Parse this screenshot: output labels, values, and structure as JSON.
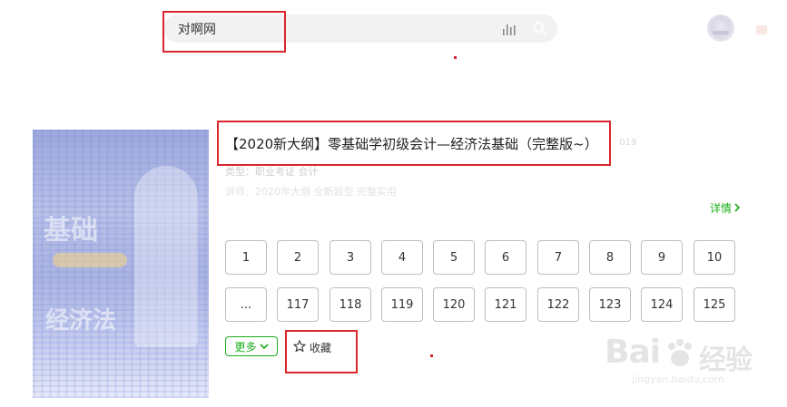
{
  "search": {
    "query": "对啊网"
  },
  "course": {
    "title": "【2020新大纲】零基础学初级会计—经济法基础（完整版~）",
    "title_tail": "· 019",
    "type_line": "类型：职业考证   会计",
    "teacher_line": "讲师：2020年大纲   全新题型   完整实用"
  },
  "detail_label": "详情",
  "episodes": {
    "row1": [
      "1",
      "2",
      "3",
      "4",
      "5",
      "6",
      "7",
      "8",
      "9",
      "10"
    ],
    "row2": [
      "...",
      "117",
      "118",
      "119",
      "120",
      "121",
      "122",
      "123",
      "124",
      "125"
    ]
  },
  "more_label": "更多",
  "favorite_label": "收藏",
  "watermark": {
    "brand": "Bai",
    "brand_cn": "经验",
    "url": "jingyan.baidu.com"
  },
  "cover_glyphs": [
    "基础",
    "经济法"
  ],
  "colors": {
    "accent_green": "#1aad19",
    "annotation_red": "#d9262c"
  },
  "icons": [
    "voice-icon",
    "search-icon",
    "chevron-right-icon",
    "chevron-down-icon",
    "star-outline-icon",
    "paw-icon"
  ]
}
